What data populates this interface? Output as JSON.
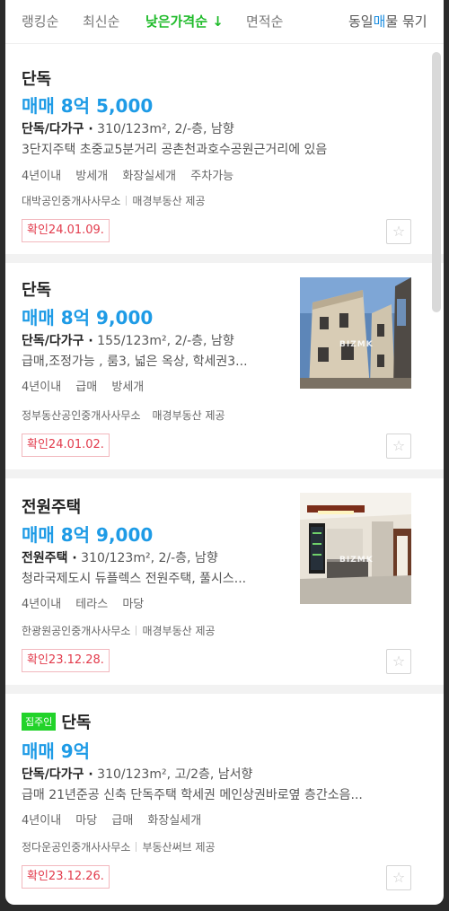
{
  "sort_tabs": [
    "랭킹순",
    "최신순",
    "낮은가격순 ↓",
    "면적순"
  ],
  "group_toggle": {
    "pre": "동일",
    "hl": "매",
    "post": "물 묶기"
  },
  "listings": [
    {
      "badge": "",
      "title": "단독",
      "price": "매매 8억 5,000",
      "spec_type": "단독/다가구 ·",
      "spec_rest": " 310/123m², 2/-층, 남향",
      "desc": "3단지주택 초중교5분거리 공촌천과호수공원근거리에 있음",
      "tags": [
        "4년이내",
        "방세개",
        "화장실세개",
        "주차가능"
      ],
      "agency": "대박공인중개사사무소",
      "provider": "매경부동산 제공",
      "confirm": "확인24.01.09.",
      "photo": null
    },
    {
      "badge": "",
      "title": "단독",
      "price": "매매 8억 9,000",
      "spec_type": "단독/다가구 ·",
      "spec_rest": " 155/123m², 2/-층, 남향",
      "desc": "급매,조정가능 , 룸3, 넓은 옥상, 학세권3...",
      "tags": [
        "4년이내",
        "급매",
        "방세개"
      ],
      "agency": "정부동산공인중개사사무소",
      "provider": "매경부동산 제공",
      "confirm": "확인24.01.02.",
      "photo": "building-exterior",
      "watermark": "BIZMK"
    },
    {
      "badge": "",
      "title": "전원주택",
      "price": "매매 8억 9,000",
      "spec_type": "전원주택 ·",
      "spec_rest": " 310/123m², 2/-층, 남향",
      "desc": "청라국제도시 듀플렉스 전원주택, 풀시스...",
      "tags": [
        "4년이내",
        "테라스",
        "마당"
      ],
      "agency": "한광원공인중개사사무소",
      "provider": "매경부동산 제공",
      "confirm": "확인23.12.28.",
      "photo": "kitchen-interior",
      "watermark": "BIZMK"
    },
    {
      "badge": "집주인",
      "title": "단독",
      "price": "매매 9억",
      "spec_type": "단독/다가구 ·",
      "spec_rest": " 310/123m², 고/2층, 남서향",
      "desc": "급매 21년준공 신축 단독주택 학세권 메인상권바로옆 층간소음...",
      "tags": [
        "4년이내",
        "마당",
        "급매",
        "화장실세개"
      ],
      "agency": "정다운공인중개사사무소",
      "provider": "부동산써브 제공",
      "confirm": "확인23.12.26.",
      "photo": null
    }
  ],
  "colors": {
    "accent_green": "#1fbb2a",
    "price_blue": "#1e9be6",
    "confirm_red": "#e23b4c",
    "owner_badge": "#22d32a"
  }
}
